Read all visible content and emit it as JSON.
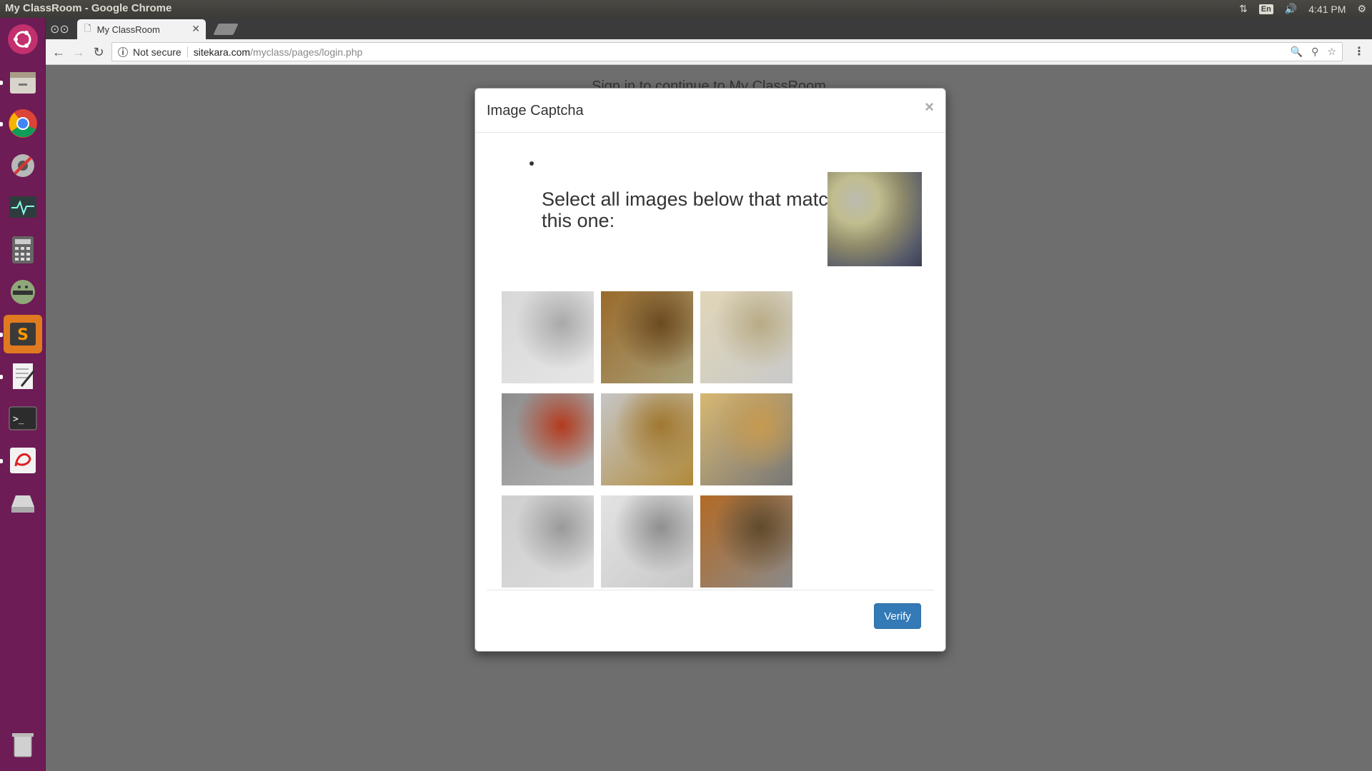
{
  "os": {
    "window_title": "My ClassRoom - Google Chrome",
    "keyboard_layout": "En",
    "clock": "4:41 PM"
  },
  "browser": {
    "tab_title": "My ClassRoom",
    "security_label": "Not secure",
    "url_host": "sitekara.com",
    "url_path": "/myclass/pages/login.php"
  },
  "page": {
    "background_text": "Sign in to continue to My ClassRoom"
  },
  "modal": {
    "title": "Image Captcha",
    "close_glyph": "×",
    "instruction": "Select all images below that match this one:",
    "verify_label": "Verify",
    "images": [
      {
        "id": "img-1",
        "colors": [
          "#d8d8d8",
          "#a9a9a9",
          "#e6e6e6"
        ]
      },
      {
        "id": "img-2",
        "colors": [
          "#9a6a2a",
          "#6b4a20",
          "#a8a07a"
        ]
      },
      {
        "id": "img-3",
        "colors": [
          "#e0d6b8",
          "#b8ab85",
          "#c9c9c9"
        ]
      },
      {
        "id": "img-4",
        "colors": [
          "#8d8d8d",
          "#b33a1e",
          "#b5b5b5"
        ]
      },
      {
        "id": "img-5",
        "colors": [
          "#c6c6c6",
          "#a07830",
          "#b18a3a"
        ]
      },
      {
        "id": "img-6",
        "colors": [
          "#d8b872",
          "#c69a50",
          "#777777"
        ]
      },
      {
        "id": "img-7",
        "colors": [
          "#cfcfcf",
          "#9a9a9a",
          "#dcdcdc"
        ]
      },
      {
        "id": "img-8",
        "colors": [
          "#e3e3e3",
          "#8f8f8f",
          "#c8c8c8"
        ]
      },
      {
        "id": "img-9",
        "colors": [
          "#b36a25",
          "#5e4a2c",
          "#8a8a8a"
        ]
      }
    ]
  },
  "colors": {
    "verify_button": "#337ab7",
    "launcher": "#6d1c55"
  }
}
